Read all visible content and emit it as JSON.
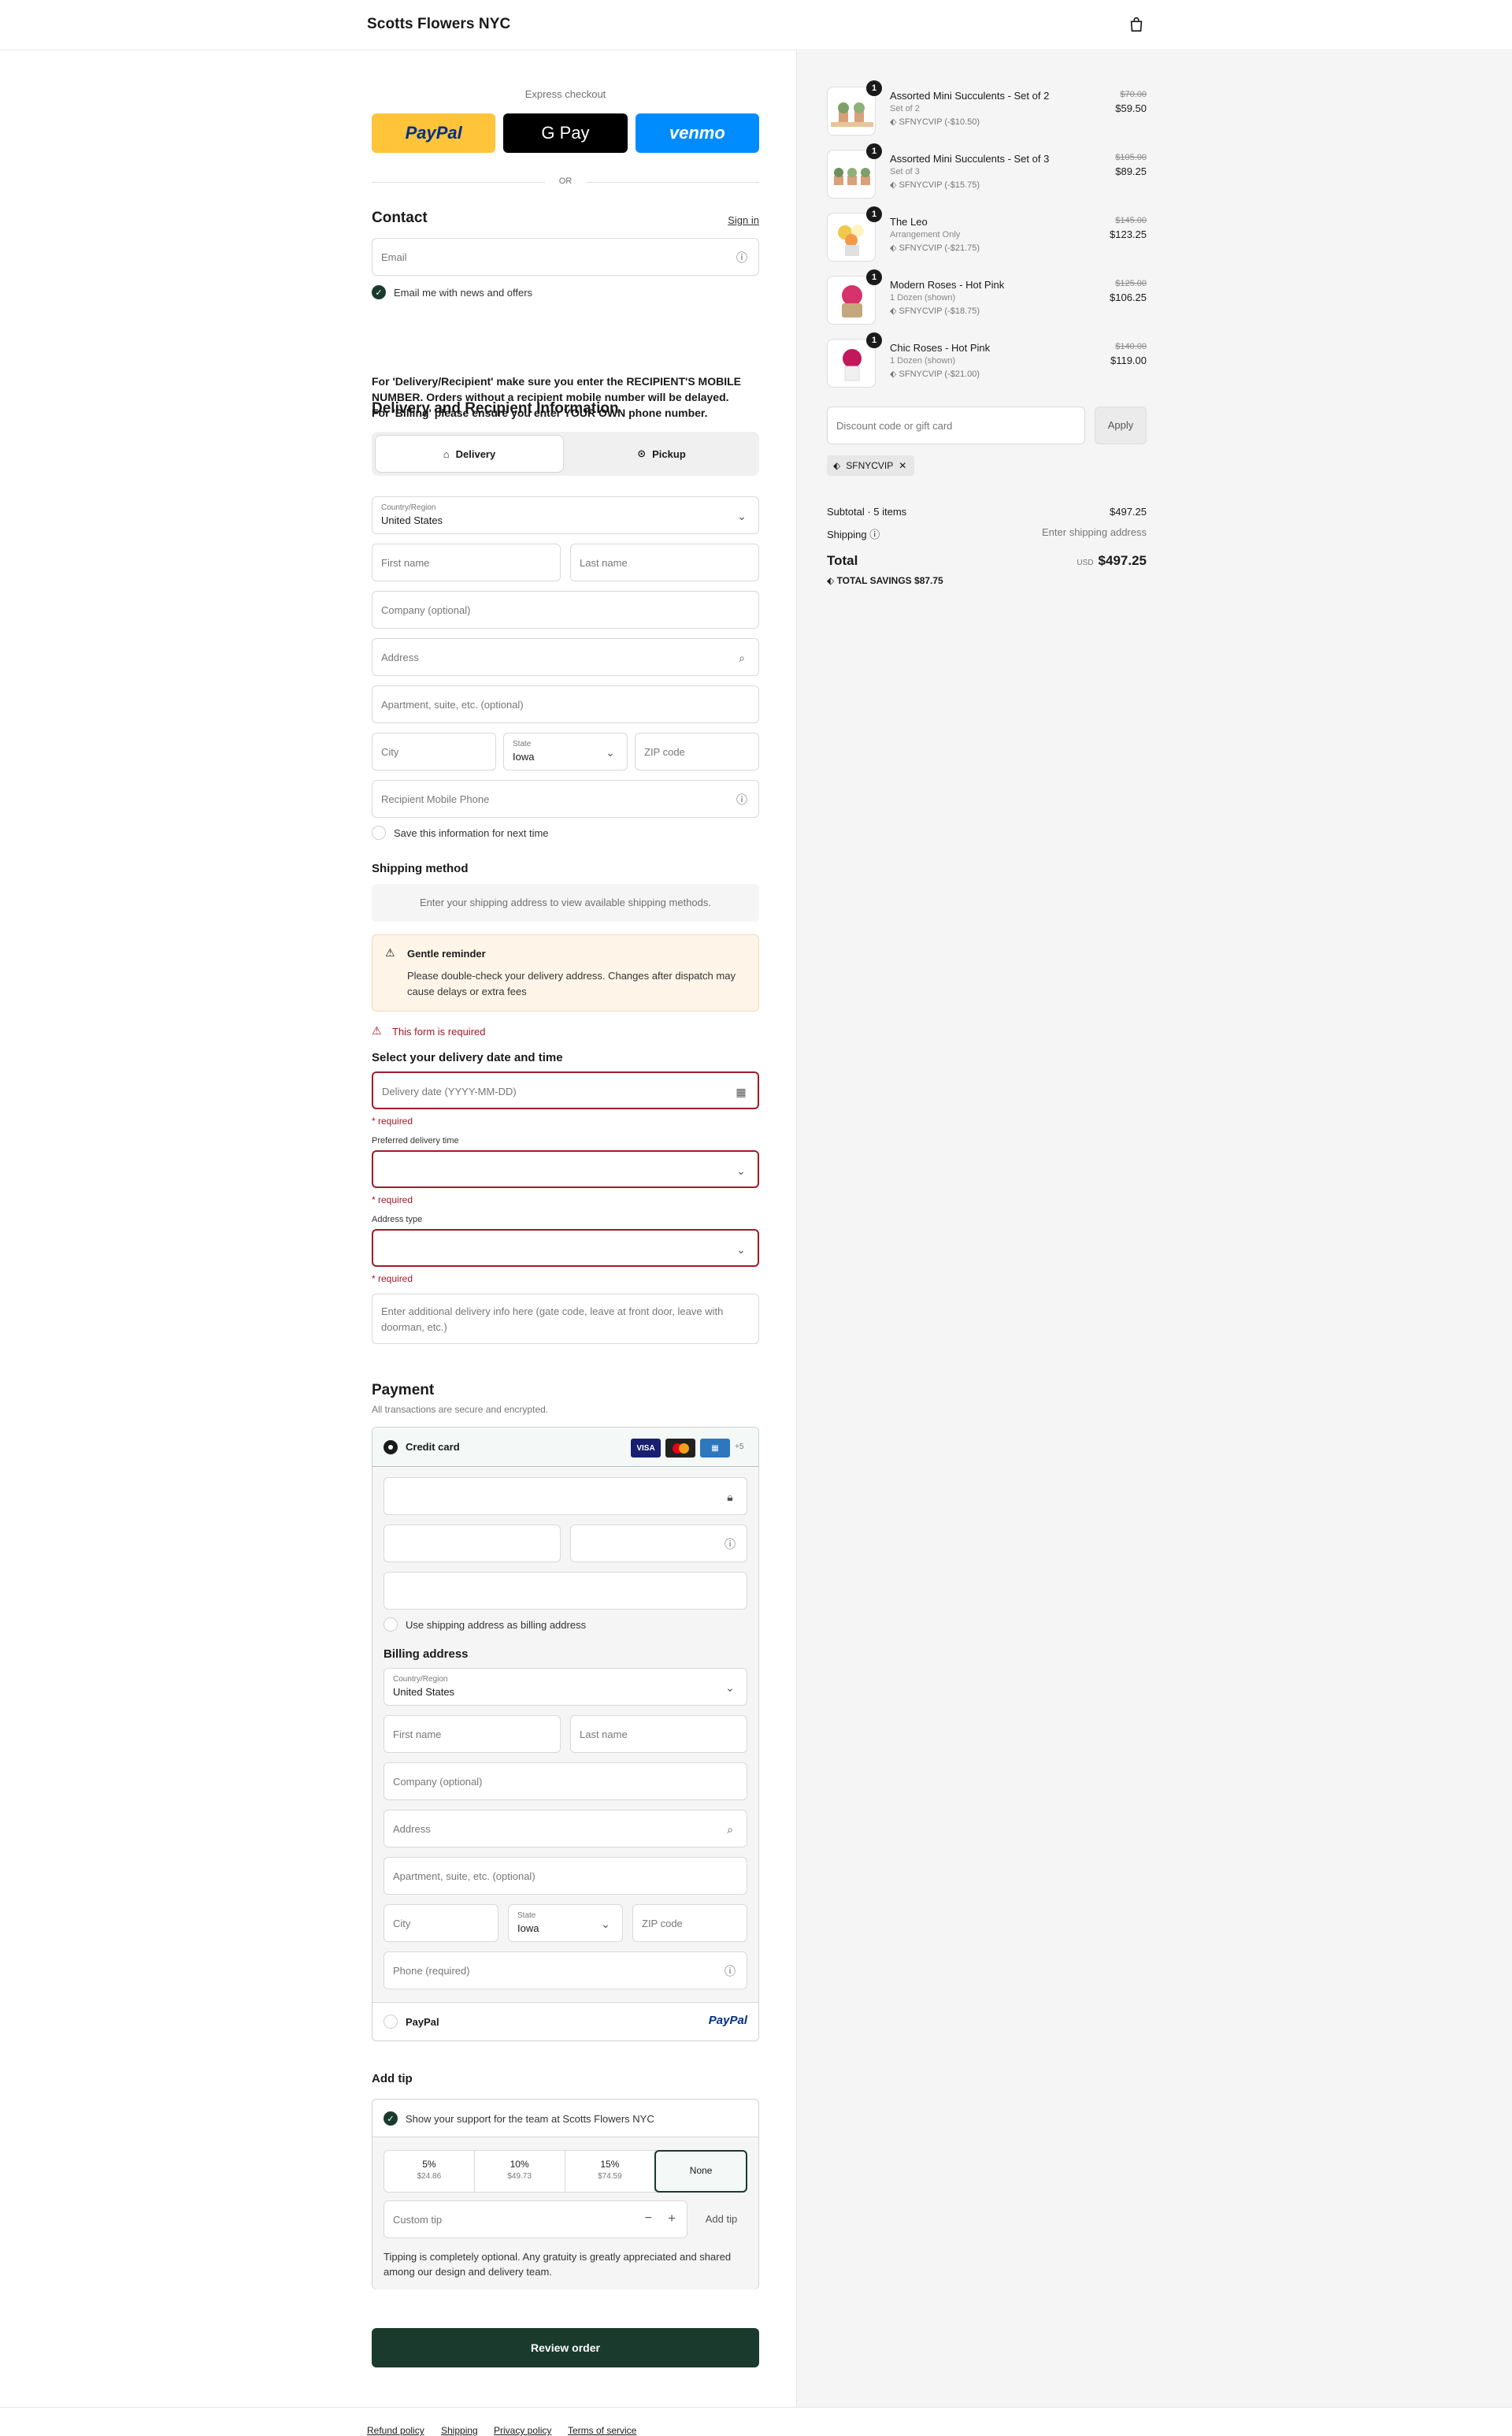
{
  "header": {
    "brand": "Scotts Flowers NYC",
    "cart_icon": "shopping-bag-icon"
  },
  "express": {
    "title": "Express checkout",
    "paypal": "PayPal",
    "gpay": "G Pay",
    "venmo": "venmo",
    "or": "OR"
  },
  "contact": {
    "title": "Contact",
    "sign_in": "Sign in",
    "email_placeholder": "Email",
    "newsletter": "Email me with news and offers"
  },
  "notice": {
    "line1": "For 'Delivery/Recipient' make sure you enter the RECIPIENT'S MOBILE",
    "line2": "NUMBER. Orders without a recipient mobile number will be delayed.",
    "line3": "For 'Billing' please ensure you enter YOUR OWN phone number."
  },
  "delivery": {
    "title": "Delivery and Recipient Information",
    "tab_delivery": "Delivery",
    "tab_pickup": "Pickup",
    "country_label": "Country/Region",
    "country_value": "United States",
    "first_name": "First name",
    "last_name": "Last name",
    "company": "Company (optional)",
    "address": "Address",
    "apartment": "Apartment, suite, etc. (optional)",
    "city": "City",
    "state_label": "State",
    "state_value": "Iowa",
    "zip": "ZIP code",
    "phone": "Recipient Mobile Phone",
    "save_info": "Save this information for next time"
  },
  "shipping": {
    "title": "Shipping method",
    "placeholder": "Enter your shipping address to view available shipping methods."
  },
  "reminder": {
    "title": "Gentle reminder",
    "line1": "Please double-check your delivery address. Changes after dispatch may",
    "line2": "cause delays or extra fees"
  },
  "schedule": {
    "form_error": "This form is required",
    "title": "Select your delivery date and time",
    "date_placeholder": "Delivery date (YYYY-MM-DD)",
    "required": "* required",
    "time_label": "Preferred delivery time",
    "addr_type_label": "Address type",
    "notes_line1": "Enter additional delivery info here (gate code, leave at front door, leave with",
    "notes_line2": "doorman, etc.)"
  },
  "payment": {
    "title": "Payment",
    "subtitle": "All transactions are secure and encrypted.",
    "credit_card": "Credit card",
    "visa": "VISA",
    "more_cards": "+5",
    "use_shipping": "Use shipping address as billing address",
    "billing_title": "Billing address",
    "country_label": "Country/Region",
    "country_value": "United States",
    "first_name": "First name",
    "last_name": "Last name",
    "company": "Company (optional)",
    "address": "Address",
    "apartment": "Apartment, suite, etc. (optional)",
    "city": "City",
    "state_label": "State",
    "state_value": "Iowa",
    "zip": "ZIP code",
    "phone": "Phone (required)",
    "paypal": "PayPal",
    "paypal_logo": "PayPal"
  },
  "tip": {
    "title": "Add tip",
    "support": "Show your support for the team at Scotts Flowers NYC",
    "options": [
      {
        "pct": "5%",
        "amt": "$24.86"
      },
      {
        "pct": "10%",
        "amt": "$49.73"
      },
      {
        "pct": "15%",
        "amt": "$74.59"
      }
    ],
    "none": "None",
    "custom_placeholder": "Custom tip",
    "minus": "−",
    "plus": "+",
    "add": "Add tip",
    "note_line1": "Tipping is completely optional. Any gratuity is greatly appreciated and shared",
    "note_line2": "among our design and delivery team."
  },
  "review": "Review order",
  "footer": {
    "refund": "Refund policy",
    "shipping": "Shipping",
    "privacy": "Privacy policy",
    "terms": "Terms of service"
  },
  "order": {
    "items": [
      {
        "qty": "1",
        "name": "Assorted Mini Succulents - Set of 2",
        "variant": "Set of 2",
        "discount": "SFNYCVIP (-$10.50)",
        "original": "$70.00",
        "price": "$59.50"
      },
      {
        "qty": "1",
        "name": "Assorted Mini Succulents - Set of 3",
        "variant": "Set of 3",
        "discount": "SFNYCVIP (-$15.75)",
        "original": "$105.00",
        "price": "$89.25"
      },
      {
        "qty": "1",
        "name": "The Leo",
        "variant": "Arrangement Only",
        "discount": "SFNYCVIP (-$21.75)",
        "original": "$145.00",
        "price": "$123.25"
      },
      {
        "qty": "1",
        "name": "Modern Roses - Hot Pink",
        "variant": "1 Dozen (shown)",
        "discount": "SFNYCVIP (-$18.75)",
        "original": "$125.00",
        "price": "$106.25"
      },
      {
        "qty": "1",
        "name": "Chic Roses - Hot Pink",
        "variant": "1 Dozen (shown)",
        "discount": "SFNYCVIP (-$21.00)",
        "original": "$140.00",
        "price": "$119.00"
      }
    ],
    "discount_placeholder": "Discount code or gift card",
    "apply": "Apply",
    "code": "SFNYCVIP",
    "subtotal_label": "Subtotal · 5 items",
    "subtotal": "$497.25",
    "shipping_label": "Shipping",
    "shipping_value": "Enter shipping address",
    "total_label": "Total",
    "currency": "USD",
    "total": "$497.25",
    "savings_label": "TOTAL SAVINGS",
    "savings": "$87.75"
  },
  "colors": {
    "accent": "#1a3a2e",
    "error": "#a11a2a",
    "paypal_yellow": "#ffc439",
    "venmo_blue": "#008cff"
  }
}
